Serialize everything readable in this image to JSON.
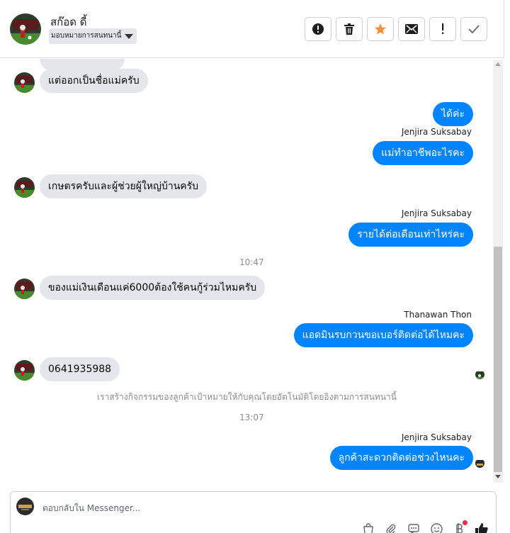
{
  "header": {
    "contact_name": "สก๊อด ดี้",
    "assign_label": "มอบหมายการสนทนานี้",
    "actions": [
      {
        "icon": "alert-circle-icon",
        "name": "mark-spam-button"
      },
      {
        "icon": "trash-icon",
        "name": "delete-button"
      },
      {
        "icon": "star-icon",
        "name": "star-button"
      },
      {
        "icon": "envelope-icon",
        "name": "mark-unread-button"
      },
      {
        "icon": "exclamation-icon",
        "name": "follow-up-button"
      },
      {
        "icon": "check-icon",
        "name": "mark-done-button"
      }
    ],
    "star_color": "#f7923a"
  },
  "messages": {
    "m1": {
      "text": "แต่ออกเป็นชื่อแม่ครับ"
    },
    "m2": {
      "text": "ได้ค่ะ"
    },
    "m3": {
      "sender": "Jenjira Suksabay",
      "text": "แม่ทำอาชีพอะไรคะ"
    },
    "m4": {
      "text": "เกษตรครับและผู้ช่วยผู้ใหญ่บ้านครับ"
    },
    "m5": {
      "sender": "Jenjira Suksabay",
      "text": "รายได้ต่อเดือนเท่าไหร่คะ"
    },
    "t1": {
      "text": "10:47"
    },
    "m6": {
      "text": "ของแม่เงินเดือนแค่6000ต้องใช้คนกู้ร่วมไหมครับ"
    },
    "m7": {
      "sender": "Thanawan Thon",
      "text": "แอดมินรบกวนขอเบอร์ติดต่อได้ไหมคะ"
    },
    "m8": {
      "text": "0641935988"
    },
    "sys": {
      "text": "เราสร้างกิจกรรมของลูกค้าเป้าหมายให้กับคุณโดยอัตโนมัติโดยอิงตามการสนทนานี้"
    },
    "t2": {
      "text": "13:07"
    },
    "m9": {
      "sender": "Jenjira Suksabay",
      "text": "ลูกค้าสะดวกติดต่อช่วงไหนคะ"
    }
  },
  "composer": {
    "placeholder": "ตอบกลับใน Messenger...",
    "icons": [
      "shopping-bag-icon",
      "paperclip-icon",
      "chat-bubble-icon",
      "emoji-icon",
      "baht-icon",
      "thumbs-up-icon"
    ]
  },
  "colors": {
    "outgoing_bubble": "#0084ff",
    "incoming_bubble": "#e4e6eb",
    "notification_dot": "#f02849"
  }
}
